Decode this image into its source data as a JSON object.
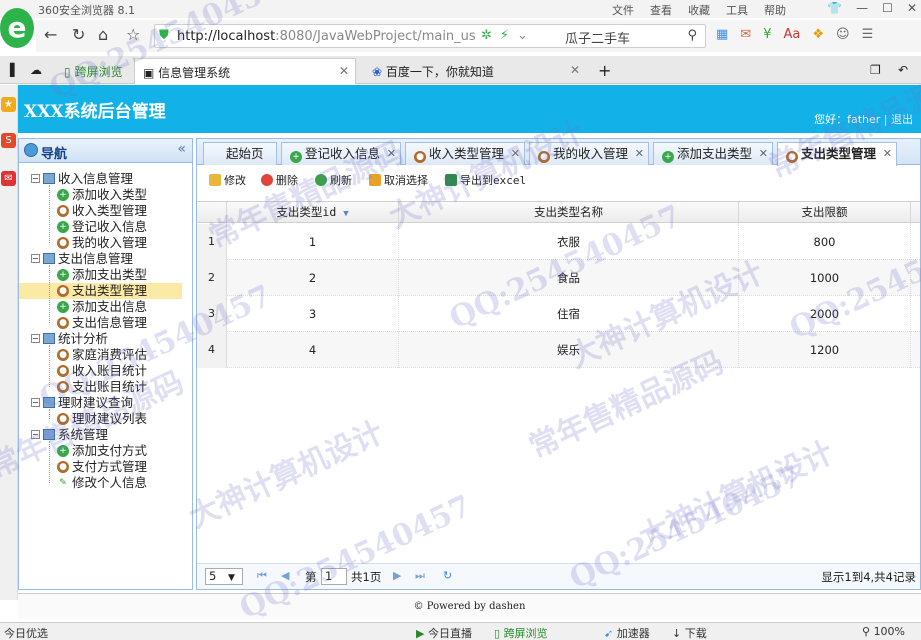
{
  "browser": {
    "window_title": "360安全浏览器 8.1",
    "menus": [
      "文件",
      "查看",
      "收藏",
      "工具",
      "帮助"
    ],
    "url_host": "http://localhost",
    "url_rest": ":8080/JavaWebProject/main_us",
    "search_text": "瓜子二手车",
    "tabs": [
      {
        "label": "跨屏浏览"
      },
      {
        "label": "信息管理系统",
        "active": true
      },
      {
        "label": "百度一下，你就知道"
      }
    ]
  },
  "app": {
    "title": "XXX系统后台管理",
    "user_text": "您好：father | 退出",
    "footer": "© Powered by dashen"
  },
  "nav": {
    "title": "导航",
    "tree": [
      {
        "type": "group",
        "label": "收入信息管理"
      },
      {
        "type": "leaf",
        "label": "添加收入类型",
        "icon": "add"
      },
      {
        "type": "leaf",
        "label": "收入类型管理",
        "icon": "user"
      },
      {
        "type": "leaf",
        "label": "登记收入信息",
        "icon": "add"
      },
      {
        "type": "leaf",
        "label": "我的收入管理",
        "icon": "user"
      },
      {
        "type": "group",
        "label": "支出信息管理"
      },
      {
        "type": "leaf",
        "label": "添加支出类型",
        "icon": "add"
      },
      {
        "type": "leaf",
        "label": "支出类型管理",
        "icon": "user",
        "selected": true
      },
      {
        "type": "leaf",
        "label": "添加支出信息",
        "icon": "add"
      },
      {
        "type": "leaf",
        "label": "支出信息管理",
        "icon": "user"
      },
      {
        "type": "group",
        "label": "统计分析"
      },
      {
        "type": "leaf",
        "label": "家庭消费评估",
        "icon": "user"
      },
      {
        "type": "leaf",
        "label": "收入账目统计",
        "icon": "user"
      },
      {
        "type": "leaf",
        "label": "支出账目统计",
        "icon": "user"
      },
      {
        "type": "group",
        "label": "理财建议查询"
      },
      {
        "type": "leaf",
        "label": "理财建议列表",
        "icon": "user"
      },
      {
        "type": "group",
        "label": "系统管理"
      },
      {
        "type": "leaf",
        "label": "添加支付方式",
        "icon": "add"
      },
      {
        "type": "leaf",
        "label": "支付方式管理",
        "icon": "user"
      },
      {
        "type": "leaf",
        "label": "修改个人信息",
        "icon": "pen"
      }
    ]
  },
  "content_tabs": [
    {
      "label": "起始页",
      "icon": ""
    },
    {
      "label": "登记收入信息",
      "icon": "add"
    },
    {
      "label": "收入类型管理",
      "icon": "user"
    },
    {
      "label": "我的收入管理",
      "icon": "user"
    },
    {
      "label": "添加支出类型",
      "icon": "add"
    },
    {
      "label": "支出类型管理",
      "icon": "user",
      "active": true
    }
  ],
  "toolbar": {
    "edit": "修改",
    "delete": "删除",
    "refresh": "刷新",
    "cancel_select": "取消选择",
    "export": "导出到excel"
  },
  "grid": {
    "columns": [
      "支出类型id",
      "支出类型名称",
      "支出限额"
    ],
    "rows": [
      {
        "num": "1",
        "id": "1",
        "name": "衣服",
        "limit": "800"
      },
      {
        "num": "2",
        "id": "2",
        "name": "食品",
        "limit": "1000"
      },
      {
        "num": "3",
        "id": "3",
        "name": "住宿",
        "limit": "2000"
      },
      {
        "num": "4",
        "id": "4",
        "name": "娱乐",
        "limit": "1200"
      }
    ]
  },
  "pager": {
    "page_size": "5",
    "page_label": "第",
    "page_value": "1",
    "total_pages": "共1页",
    "info": "显示1到4,共4记录"
  },
  "statusbar": {
    "left": "今日优选",
    "items": [
      "今日直播",
      "跨屏浏览",
      "加速器",
      "下载",
      "100%"
    ]
  },
  "watermarks": [
    "QQ:254540457",
    "大神计算机设计",
    "常年售精品源码"
  ]
}
